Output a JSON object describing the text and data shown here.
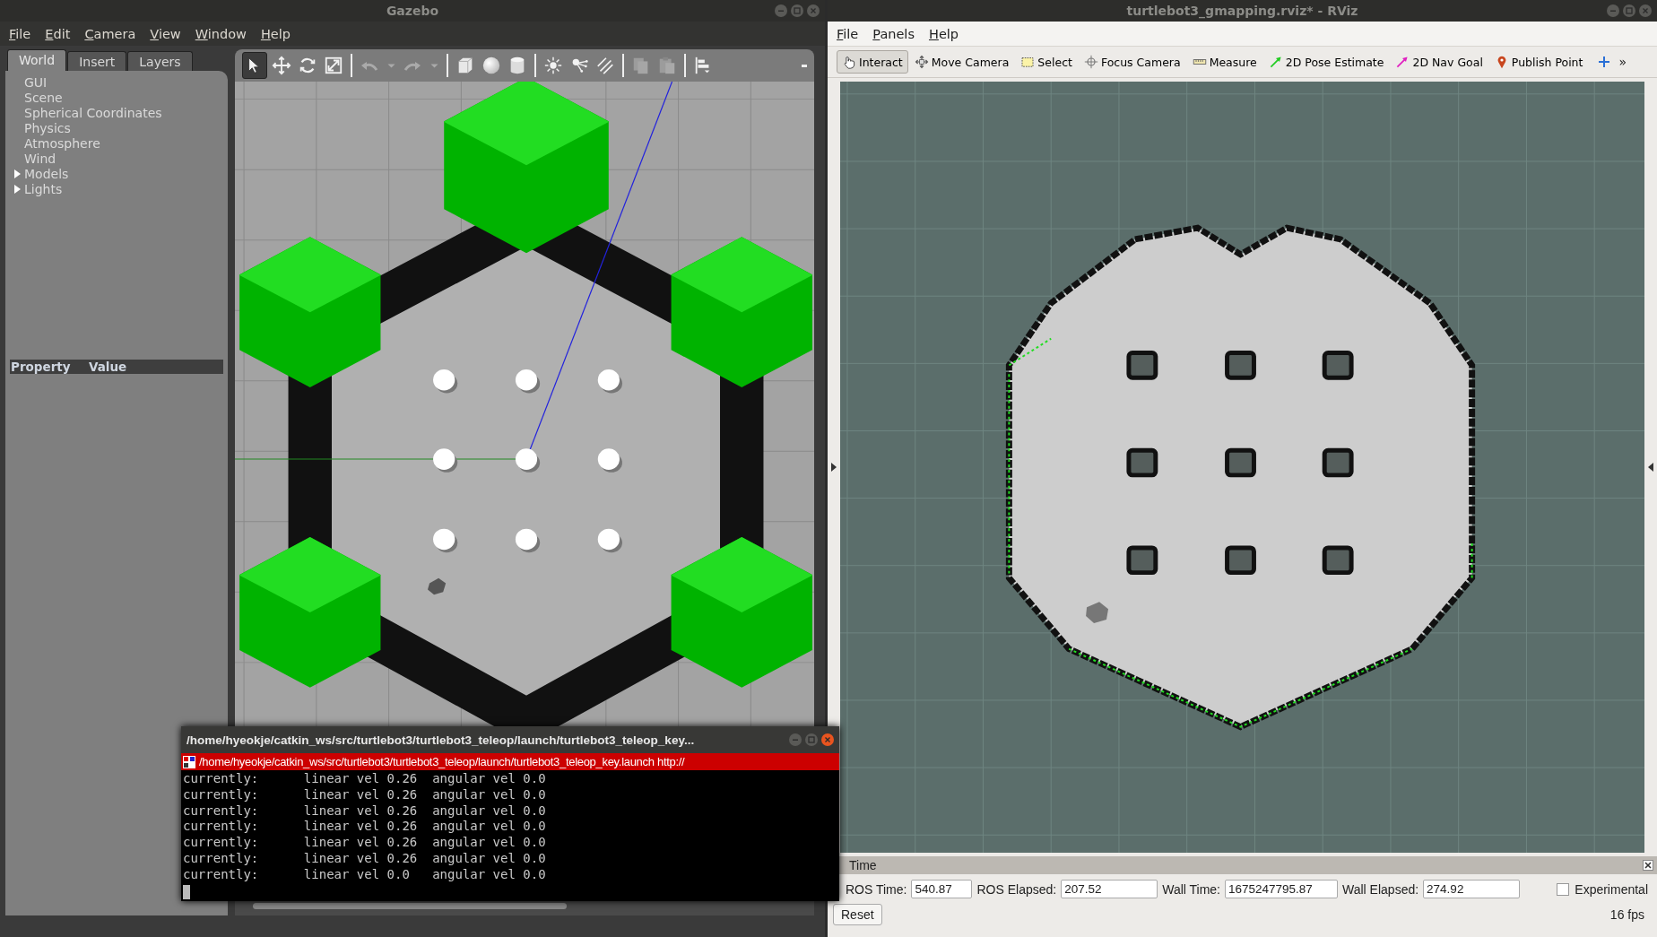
{
  "gazebo": {
    "title": "Gazebo",
    "menu": [
      "File",
      "Edit",
      "Camera",
      "View",
      "Window",
      "Help"
    ],
    "tabs": [
      {
        "label": "World",
        "selected": true
      },
      {
        "label": "Insert",
        "selected": false
      },
      {
        "label": "Layers",
        "selected": false
      }
    ],
    "tree": [
      {
        "label": "GUI",
        "kind": "leaf"
      },
      {
        "label": "Scene",
        "kind": "leaf"
      },
      {
        "label": "Spherical Coordinates",
        "kind": "leaf"
      },
      {
        "label": "Physics",
        "kind": "leaf"
      },
      {
        "label": "Atmosphere",
        "kind": "leaf"
      },
      {
        "label": "Wind",
        "kind": "leaf"
      },
      {
        "label": "Models",
        "kind": "group",
        "expanded": false
      },
      {
        "label": "Lights",
        "kind": "group",
        "expanded": false
      }
    ],
    "property_columns": [
      "Property",
      "Value"
    ],
    "toolbar": [
      {
        "kind": "select",
        "selected": true,
        "disabled": false
      },
      {
        "kind": "translate",
        "selected": false,
        "disabled": false
      },
      {
        "kind": "rotate",
        "selected": false,
        "disabled": false
      },
      {
        "kind": "scale",
        "selected": false,
        "disabled": false
      },
      {
        "kind": "separator"
      },
      {
        "kind": "undo",
        "selected": false,
        "disabled": true
      },
      {
        "kind": "dropdown",
        "selected": false,
        "disabled": true
      },
      {
        "kind": "redo",
        "selected": false,
        "disabled": true
      },
      {
        "kind": "dropdown",
        "selected": false,
        "disabled": true
      },
      {
        "kind": "separator"
      },
      {
        "kind": "box",
        "selected": false,
        "disabled": false
      },
      {
        "kind": "sphere",
        "selected": false,
        "disabled": false
      },
      {
        "kind": "cylinder",
        "selected": false,
        "disabled": false
      },
      {
        "kind": "separator"
      },
      {
        "kind": "point-light",
        "selected": false,
        "disabled": false
      },
      {
        "kind": "spot-light",
        "selected": false,
        "disabled": false
      },
      {
        "kind": "directional-light",
        "selected": false,
        "disabled": false
      },
      {
        "kind": "separator"
      },
      {
        "kind": "copy",
        "selected": false,
        "disabled": true
      },
      {
        "kind": "paste",
        "selected": false,
        "disabled": true
      },
      {
        "kind": "separator"
      },
      {
        "kind": "align",
        "selected": false,
        "disabled": false
      }
    ]
  },
  "rviz": {
    "title": "turtlebot3_gmapping.rviz* - RViz",
    "menu": [
      "File",
      "Panels",
      "Help"
    ],
    "tools": [
      {
        "label": "Interact",
        "kind": "interact",
        "selected": true
      },
      {
        "label": "Move Camera",
        "kind": "move-camera",
        "selected": false
      },
      {
        "label": "Select",
        "kind": "select",
        "selected": false
      },
      {
        "label": "Focus Camera",
        "kind": "focus",
        "selected": false
      },
      {
        "label": "Measure",
        "kind": "measure",
        "selected": false
      },
      {
        "label": "2D Pose Estimate",
        "kind": "pose",
        "selected": false
      },
      {
        "label": "2D Nav Goal",
        "kind": "goal",
        "selected": false
      },
      {
        "label": "Publish Point",
        "kind": "point",
        "selected": false
      }
    ],
    "overflow": "»",
    "time_panel": {
      "title": "Time",
      "fields": [
        {
          "label": "ROS Time:",
          "value": "540.87"
        },
        {
          "label": "ROS Elapsed:",
          "value": "207.52"
        },
        {
          "label": "Wall Time:",
          "value": "1675247795.87"
        },
        {
          "label": "Wall Elapsed:",
          "value": "274.92"
        }
      ],
      "experimental": {
        "label": "Experimental",
        "checked": false
      },
      "reset": "Reset",
      "fps": "16 fps"
    }
  },
  "terminal": {
    "title": "/home/hyeokje/catkin_ws/src/turtlebot3/turtlebot3_teleop/launch/turtlebot3_teleop_key...",
    "tab": "/home/hyeokje/catkin_ws/src/turtlebot3/turtlebot3_teleop/launch/turtlebot3_teleop_key.launch http://",
    "lines": [
      "currently:      linear vel 0.26  angular vel 0.0",
      "currently:      linear vel 0.26  angular vel 0.0",
      "currently:      linear vel 0.26  angular vel 0.0",
      "currently:      linear vel 0.26  angular vel 0.0",
      "currently:      linear vel 0.26  angular vel 0.0",
      "currently:      linear vel 0.26  angular vel 0.0",
      "currently:      linear vel 0.0   angular vel 0.0"
    ]
  }
}
